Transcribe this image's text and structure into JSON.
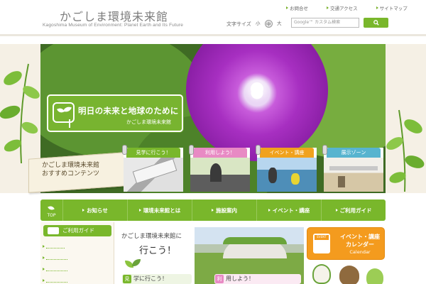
{
  "header": {
    "title": "かごしま環境未来館",
    "subtitle": "Kagoshima Museum of Environment: Planet Earth and Its Future",
    "top_links": [
      "お問合せ",
      "交通アクセス",
      "サイトマップ"
    ],
    "font_size": {
      "label": "文字サイズ",
      "options": [
        "小",
        "中",
        "大"
      ],
      "selected": "中"
    },
    "search": {
      "placeholder": "Google™ カスタム検索",
      "button_icon": "search-icon"
    }
  },
  "hero": {
    "banner_title": "明日の未来と地球のために",
    "banner_sub": "かごしま環境未来館"
  },
  "recommend": {
    "label_line1": "かごしま環境未来館",
    "label_line2": "おすすめコンテンツ",
    "cards": [
      {
        "tab": "見学に行こう！",
        "tab_color": "#79b72b"
      },
      {
        "tab": "利用しよう！",
        "tab_color": "#e88ac4"
      },
      {
        "tab": "イベント・講座",
        "tab_color": "#f0a21e"
      },
      {
        "tab": "展示ゾーン",
        "tab_color": "#57b4cf"
      }
    ]
  },
  "nav": {
    "top_label": "TOP",
    "items": [
      "お知らせ",
      "環境未来館とは",
      "施設案内",
      "イベント・講座",
      "ご利用ガイド"
    ]
  },
  "sidebar": {
    "heading": "ご利用ガイド"
  },
  "main": {
    "go_line1": "かごしま環境未来館に",
    "go_line2": "行こう！",
    "pill1_badge": "見",
    "pill1_text": "学に行こう！",
    "pill2_badge": "利",
    "pill2_text": "用しよう！"
  },
  "event_button": {
    "badge": "EVENT",
    "line1": "イベント・講座",
    "line2": "カレンダー",
    "line3": "Calendar"
  },
  "colors": {
    "brand_green": "#79b72b",
    "orange": "#f49b1e",
    "pink": "#e88ac4",
    "blue": "#57b4cf"
  }
}
